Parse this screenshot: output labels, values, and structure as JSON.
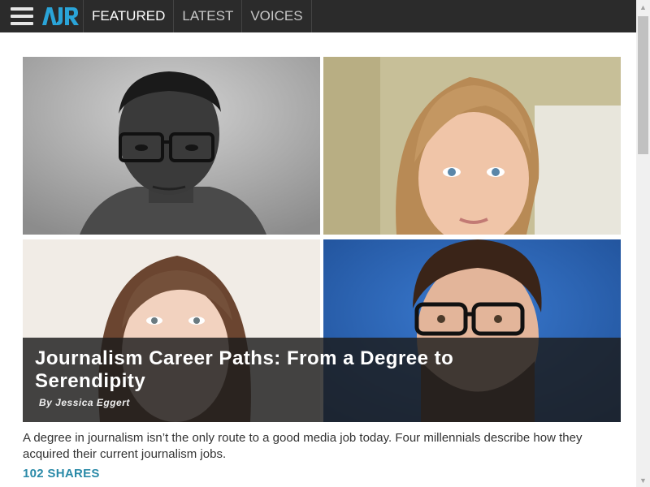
{
  "header": {
    "logo_text": "AJR",
    "nav": [
      {
        "label": "FEATURED",
        "active": true
      },
      {
        "label": "LATEST",
        "active": false
      },
      {
        "label": "VOICES",
        "active": false
      }
    ]
  },
  "article": {
    "title": "Journalism Career Paths: From a Degree to Serendipity",
    "byline": "By Jessica Eggert",
    "summary": "A degree in journalism isn’t the only route to a good media job today. Four millennials describe how they acquired their current journalism jobs.",
    "shares": "102 SHARES"
  },
  "colors": {
    "topbar": "#2b2b2b",
    "logo": "#2aa4d8",
    "shares": "#2a8aa8"
  },
  "icons": [
    "menu-icon",
    "scroll-up-icon",
    "scroll-down-icon"
  ]
}
